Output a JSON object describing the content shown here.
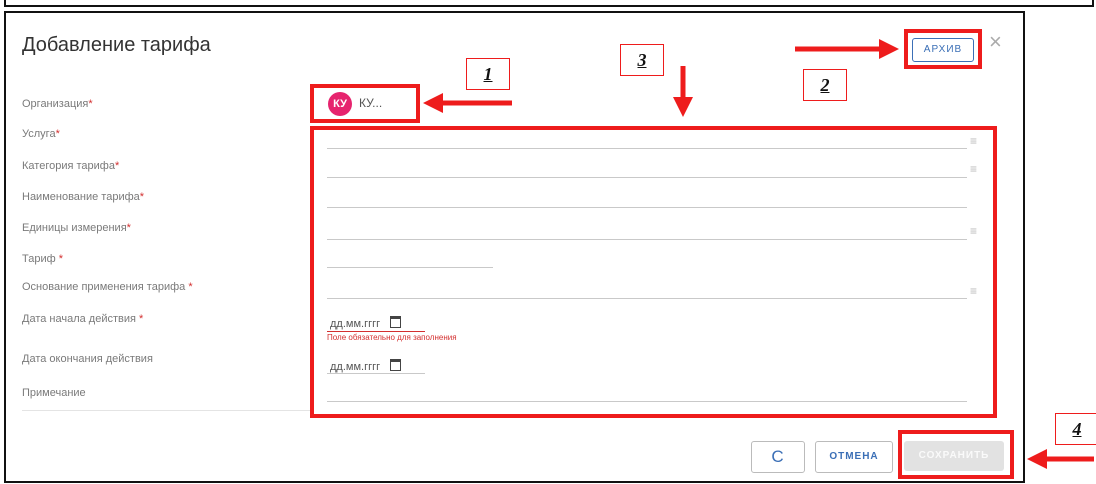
{
  "dialog": {
    "title": "Добавление тарифа",
    "close_icon": "×",
    "archive_label": "АРХИВ"
  },
  "org": {
    "avatar_initials": "КУ",
    "name": "КУ..."
  },
  "fields": [
    {
      "label": "Организация",
      "required": "*"
    },
    {
      "label": "Услуга",
      "required": "*"
    },
    {
      "label": "Категория тарифа",
      "required": "*"
    },
    {
      "label": "Наименование тарифа",
      "required": "*"
    },
    {
      "label": "Единицы измерения",
      "required": "*"
    },
    {
      "label": "Тариф",
      "required": "*"
    },
    {
      "label": "Основание применения тарифа",
      "required": "*"
    },
    {
      "label": "Дата начала действия",
      "required": "*"
    },
    {
      "label": "Дата окончания действия",
      "required": ""
    },
    {
      "label": "Примечание",
      "required": ""
    }
  ],
  "menu_icon": "≡",
  "date_start": {
    "placeholder": "дд.мм.гггг",
    "error": "Поле обязательно для заполнения"
  },
  "date_end": {
    "placeholder": "дд.мм.гггг"
  },
  "buttons": {
    "refresh": "C",
    "cancel": "ОТМЕНА",
    "save": "СОХРАНИТЬ"
  },
  "callouts": [
    "1",
    "2",
    "3",
    "4"
  ],
  "colors": {
    "callout": "#ee1c1c",
    "accent": "#3b6fb6",
    "avatar": "#e6246e",
    "required": "#d32f2f"
  }
}
